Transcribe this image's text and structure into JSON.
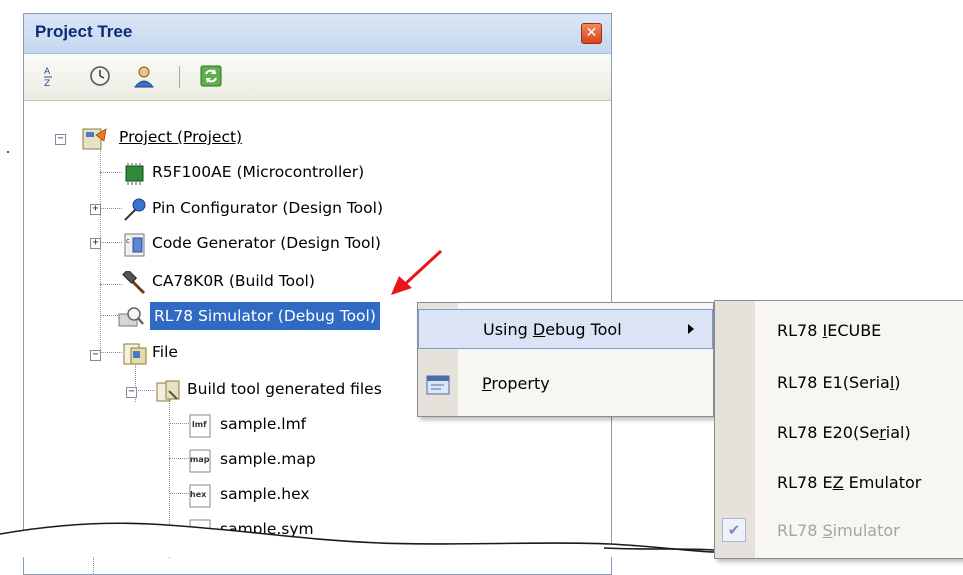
{
  "panel": {
    "title": "Project Tree",
    "close_symbol": "✕"
  },
  "toolbar": {
    "buttons": [
      {
        "name": "sort-az-icon",
        "tooltip": ""
      },
      {
        "name": "clock-icon",
        "tooltip": ""
      },
      {
        "name": "person-icon",
        "tooltip": ""
      },
      {
        "name": "refresh-icon",
        "tooltip": ""
      }
    ],
    "sort_glyph_top": "A",
    "sort_glyph_bottom": "Z"
  },
  "tree": {
    "items": [
      {
        "label": "Project (Project)",
        "icon": "project-icon",
        "expander": "−",
        "underline": true
      },
      {
        "label": "R5F100AE (Microcontroller)",
        "icon": "chip-icon"
      },
      {
        "label": "Pin Configurator (Design Tool)",
        "icon": "pin-icon",
        "expander": "+"
      },
      {
        "label": "Code Generator (Design Tool)",
        "icon": "code-gen-icon",
        "expander": "+"
      },
      {
        "label": "CA78K0R (Build Tool)",
        "icon": "hammer-icon"
      },
      {
        "label": "RL78 Simulator (Debug Tool)",
        "icon": "debug-tool-icon",
        "selected": true
      },
      {
        "label": "File",
        "icon": "file-folder-icon",
        "expander": "−"
      },
      {
        "label": "Build tool generated files",
        "icon": "build-files-icon",
        "expander": "−"
      },
      {
        "label": "sample.lmf",
        "icon": "lmf-file-icon",
        "icon_text": "lmf"
      },
      {
        "label": "sample.map",
        "icon": "map-file-icon",
        "icon_text": "map"
      },
      {
        "label": "sample.hex",
        "icon": "hex-file-icon",
        "icon_text": "hex"
      },
      {
        "label": "sample.sym",
        "icon": "sym-file-icon",
        "icon_text": "sym"
      }
    ]
  },
  "context_menu": {
    "items": [
      {
        "label": "Using Debug Tool",
        "mnemonic": "D",
        "has_submenu": true,
        "highlighted": true
      },
      {
        "label": "Property",
        "mnemonic": "P",
        "icon": "property-icon"
      }
    ]
  },
  "submenu": {
    "items": [
      {
        "label": "RL78 IECUBE",
        "mnemonic": "I",
        "enabled": true
      },
      {
        "label": "RL78 E1(Serial)",
        "mnemonic": "l",
        "enabled": true
      },
      {
        "label": "RL78 E20(Serial)",
        "mnemonic": "r",
        "enabled": true
      },
      {
        "label": "RL78 EZ Emulator",
        "mnemonic": "Z",
        "enabled": true
      },
      {
        "label": "RL78 Simulator",
        "mnemonic": "S",
        "enabled": false,
        "checked": true
      }
    ],
    "check_glyph": "✔"
  },
  "colors": {
    "selection": "#316ac5",
    "title_text": "#0b2b78",
    "pointer_arrow": "#e8141a",
    "disabled_text": "#a4a4a4"
  }
}
